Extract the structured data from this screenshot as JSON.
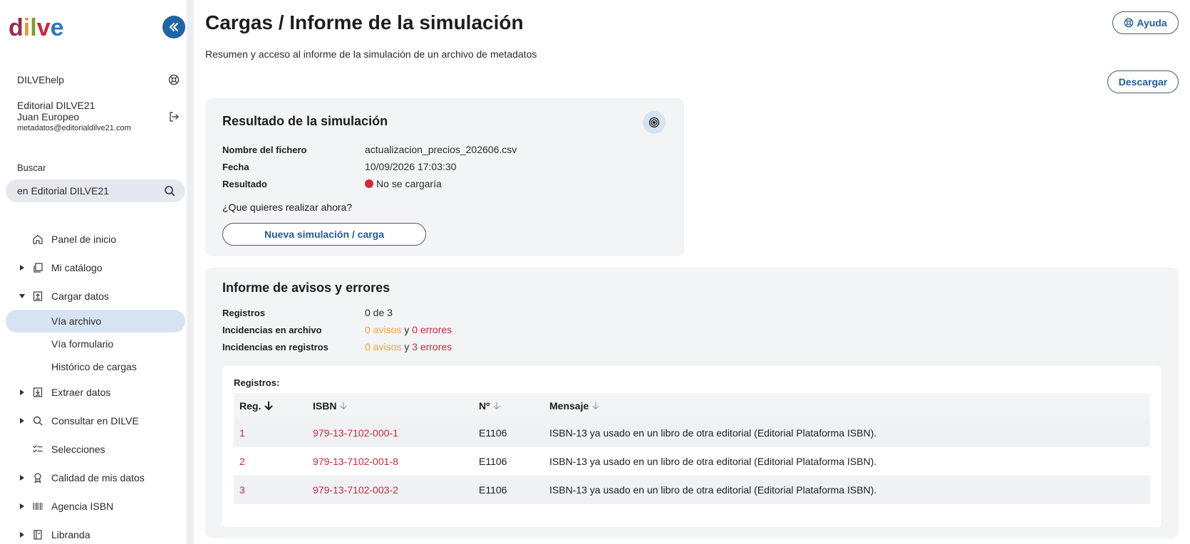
{
  "brand": {
    "logo_text": "dilve"
  },
  "sidebar": {
    "help_label": "DILVEhelp",
    "org": "Editorial DILVE21",
    "user": "Juan Europeo",
    "email": "metadatos@editorialdilve21.com",
    "search_label": "Buscar",
    "search_value": "en Editorial DILVE21",
    "nav": [
      {
        "label": "Panel de inicio",
        "icon": "home-icon"
      },
      {
        "label": "Mi catálogo",
        "icon": "catalog-icon"
      },
      {
        "label": "Cargar datos",
        "icon": "upload-icon"
      },
      {
        "label": "Vía archivo"
      },
      {
        "label": "Vía formulario"
      },
      {
        "label": "Histórico de cargas"
      },
      {
        "label": "Extraer datos",
        "icon": "download-icon"
      },
      {
        "label": "Consultar en DILVE",
        "icon": "search-icon"
      },
      {
        "label": "Selecciones",
        "icon": "checklist-icon"
      },
      {
        "label": "Calidad de mis datos",
        "icon": "award-icon"
      },
      {
        "label": "Agencia ISBN",
        "icon": "barcode-icon"
      },
      {
        "label": "Libranda",
        "icon": "book-icon"
      }
    ]
  },
  "header": {
    "title": "Cargas / Informe de la simulación",
    "subtitle": "Resumen y acceso al informe de la simulación de un archivo de metadatos",
    "help_button": "Ayuda",
    "download_button": "Descargar"
  },
  "result": {
    "title": "Resultado de la simulación",
    "file_label": "Nombre del fichero",
    "file_value": "actualizacion_precios_202606.csv",
    "date_label": "Fecha",
    "date_value": "10/09/2026 17:03:30",
    "result_label": "Resultado",
    "result_value": "No se cargaría",
    "question": "¿Que quieres realizar ahora?",
    "action_button": "Nueva simulación / carga"
  },
  "report": {
    "title": "Informe de avisos y errores",
    "records_label": "Registros",
    "records_value": "0 de 3",
    "file_issues_label": "Incidencias en archivo",
    "file_warnings": "0 avisos",
    "file_y": "y",
    "file_errors": "0 errores",
    "record_issues_label": "Incidencias en registros",
    "record_warnings": "0 avisos",
    "record_y": "y",
    "record_errors": "3 errores",
    "table_caption": "Registros:",
    "columns": [
      "Reg.",
      "ISBN",
      "Nº",
      "Mensaje"
    ],
    "rows": [
      {
        "reg": "1",
        "isbn": "979-13-7102-000-1",
        "num": "E1106",
        "msg": "ISBN-13 ya usado en un libro de otra editorial (Editorial Plataforma ISBN)."
      },
      {
        "reg": "2",
        "isbn": "979-13-7102-001-8",
        "num": "E1106",
        "msg": "ISBN-13 ya usado en un libro de otra editorial (Editorial Plataforma ISBN)."
      },
      {
        "reg": "3",
        "isbn": "979-13-7102-003-2",
        "num": "E1106",
        "msg": "ISBN-13 ya usado en un libro de otra editorial (Editorial Plataforma ISBN)."
      }
    ]
  },
  "colors": {
    "accent": "#1f66a6",
    "error": "#c8283a",
    "warning": "#f2a33a",
    "card_bg": "#f3f4f6",
    "active_nav": "#d6e3f3"
  }
}
